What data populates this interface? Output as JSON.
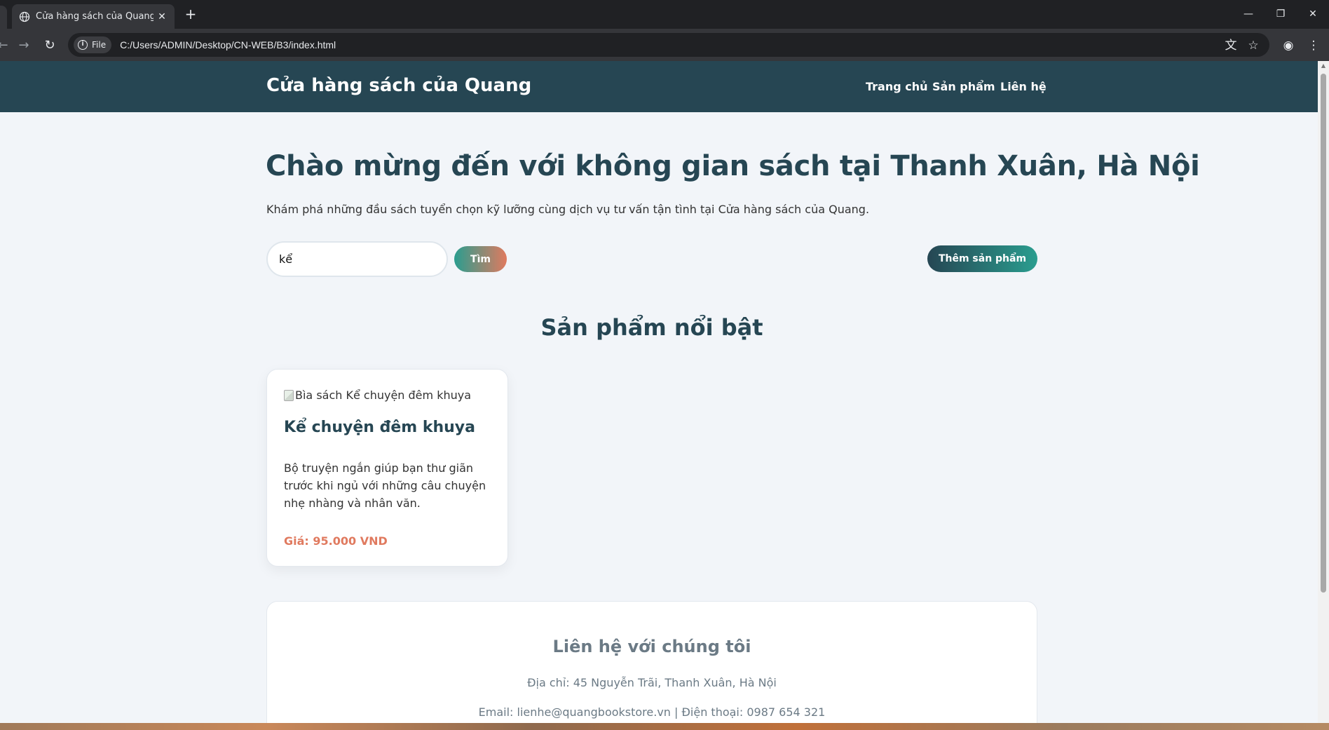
{
  "browser": {
    "tab_title": "Cửa hàng sách của Quang",
    "tab_close": "✕",
    "new_tab": "+",
    "chip_label": "File",
    "url": "C:/Users/ADMIN/Desktop/CN-WEB/B3/index.html",
    "window_controls": {
      "minimize": "—",
      "restore": "❐",
      "close": "✕"
    },
    "icons": [
      "back-icon",
      "forward-icon",
      "reload-icon",
      "translate-icon",
      "bookmark-star-icon",
      "profile-icon",
      "menu-icon"
    ]
  },
  "header": {
    "brand": "Cửa hàng sách của Quang",
    "nav": [
      "Trang chủ",
      "Sản phẩm",
      "Liên hệ"
    ]
  },
  "hero": {
    "title": "Chào mừng đến với không gian sách tại Thanh Xuân, Hà Nội",
    "subtitle": "Khám phá những đầu sách tuyển chọn kỹ lưỡng cùng dịch vụ tư vấn tận tình tại Cửa hàng sách của Quang."
  },
  "search": {
    "value": "kể",
    "button": "Tìm"
  },
  "add_product_button": "Thêm sản phẩm",
  "featured": {
    "title": "Sản phẩm nổi bật",
    "products": [
      {
        "image_alt": "Bìa sách Kể chuyện đêm khuya",
        "name": "Kể chuyện đêm khuya",
        "description": "Bộ truyện ngắn giúp bạn thư giãn trước khi ngủ với những câu chuyện nhẹ nhàng và nhân văn.",
        "price": "Giá: 95.000 VND"
      }
    ]
  },
  "contact": {
    "title": "Liên hệ với chúng tôi",
    "address": "Địa chỉ: 45 Nguyễn Trãi, Thanh Xuân, Hà Nội",
    "email_phone": "Email: lienhe@quangbookstore.vn | Điện thoại: 0987 654 321"
  },
  "colors": {
    "header_bg": "#264653",
    "accent_teal": "#2a9d8f",
    "accent_coral": "#e07a5f",
    "page_bg": "#f2f5f9"
  }
}
